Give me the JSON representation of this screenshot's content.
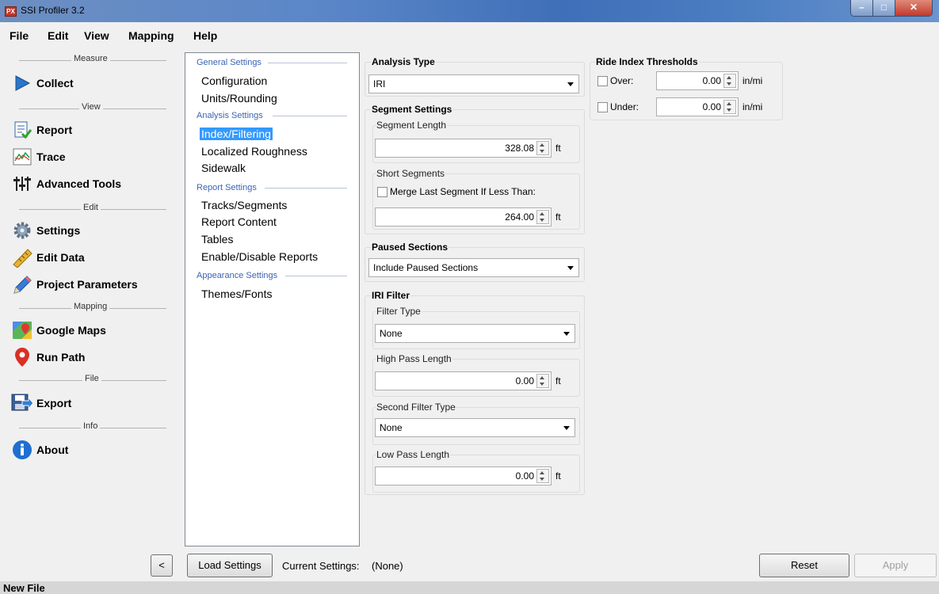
{
  "window": {
    "title": "SSI Profiler 3.2",
    "app_icon": "PX"
  },
  "menu": [
    "File",
    "Edit",
    "View",
    "Mapping",
    "Help"
  ],
  "nav": {
    "sections": {
      "measure": "Measure",
      "view": "View",
      "edit": "Edit",
      "mapping": "Mapping",
      "file": "File",
      "info": "Info"
    },
    "items": {
      "collect": "Collect",
      "report": "Report",
      "trace": "Trace",
      "advanced_tools": "Advanced Tools",
      "settings": "Settings",
      "edit_data": "Edit Data",
      "project_parameters": "Project Parameters",
      "google_maps": "Google Maps",
      "run_path": "Run Path",
      "export": "Export",
      "about": "About"
    },
    "collapse_label": "<"
  },
  "settings_list": {
    "general": "General Settings",
    "general_items": [
      "Configuration",
      "Units/Rounding"
    ],
    "analysis": "Analysis Settings",
    "analysis_items": [
      "Index/Filtering",
      "Localized Roughness",
      "Sidewalk"
    ],
    "report": "Report Settings",
    "report_items": [
      "Tracks/Segments",
      "Report Content",
      "Tables",
      "Enable/Disable Reports"
    ],
    "appearance": "Appearance Settings",
    "appearance_items": [
      "Themes/Fonts"
    ],
    "selected": "Index/Filtering"
  },
  "analysis_type": {
    "title": "Analysis Type",
    "value": "IRI"
  },
  "segment_settings": {
    "title": "Segment Settings",
    "segment_length_label": "Segment Length",
    "segment_length": "328.08",
    "unit": "ft",
    "short_segments_label": "Short Segments",
    "merge_label": "Merge Last Segment If Less Than:",
    "merge_checked": false,
    "merge_value": "264.00"
  },
  "paused_sections": {
    "title": "Paused Sections",
    "value": "Include Paused Sections"
  },
  "iri_filter": {
    "title": "IRI Filter",
    "filter_type_label": "Filter Type",
    "filter_type": "None",
    "high_pass_label": "High Pass Length",
    "high_pass": "0.00",
    "second_filter_label": "Second Filter Type",
    "second_filter": "None",
    "low_pass_label": "Low Pass Length",
    "low_pass": "0.00",
    "unit": "ft"
  },
  "ride_index": {
    "title": "Ride Index Thresholds",
    "over_label": "Over:",
    "over_value": "0.00",
    "under_label": "Under:",
    "under_value": "0.00",
    "unit": "in/mi"
  },
  "footer": {
    "load_settings": "Load Settings",
    "current_settings_label": "Current Settings:",
    "current_settings_value": "(None)",
    "reset": "Reset",
    "apply": "Apply"
  },
  "status": "New File"
}
